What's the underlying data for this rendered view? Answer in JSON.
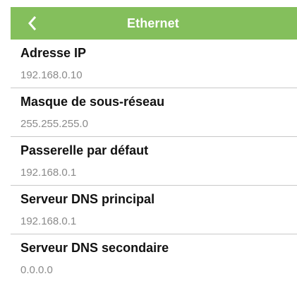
{
  "header": {
    "title": "Ethernet",
    "back_icon": "chevron-left-icon",
    "background_color": "#84bf5c",
    "text_color": "#ffffff"
  },
  "settings": [
    {
      "label": "Adresse IP",
      "value": "192.168.0.10"
    },
    {
      "label": "Masque de sous-réseau",
      "value": "255.255.255.0"
    },
    {
      "label": "Passerelle par défaut",
      "value": "192.168.0.1"
    },
    {
      "label": "Serveur DNS principal",
      "value": "192.168.0.1"
    },
    {
      "label": "Serveur DNS secondaire",
      "value": "0.0.0.0"
    }
  ]
}
